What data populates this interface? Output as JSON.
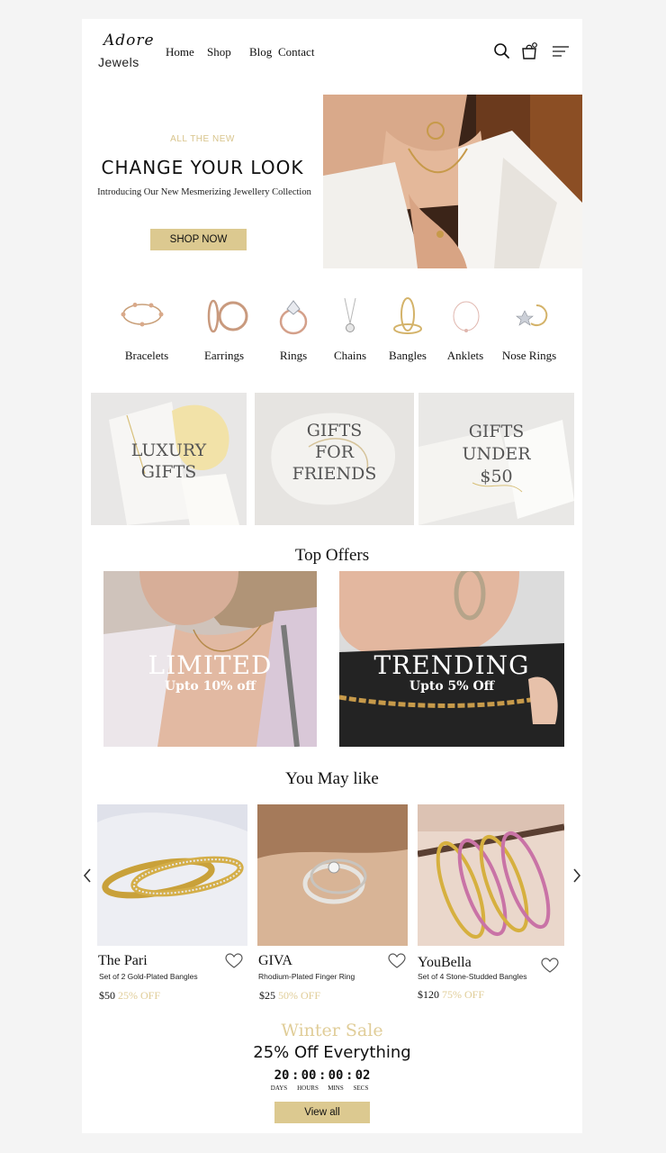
{
  "brand": {
    "script": "Adore",
    "word": "Jewels"
  },
  "nav": {
    "items": [
      "Home",
      "Shop",
      "Blog",
      "Contact"
    ]
  },
  "header_icons": [
    "search-icon",
    "cart-icon",
    "menu-icon"
  ],
  "hero": {
    "kicker": "ALL THE NEW",
    "title": "CHANGE YOUR LOOK",
    "subtitle": "Introducing Our New Mesmerizing Jewellery Collection",
    "cta": "SHOP NOW"
  },
  "categories": [
    {
      "label": "Bracelets",
      "icon": "bracelet-icon"
    },
    {
      "label": "Earrings",
      "icon": "earrings-icon"
    },
    {
      "label": "Rings",
      "icon": "ring-icon"
    },
    {
      "label": "Chains",
      "icon": "chain-icon"
    },
    {
      "label": "Bangles",
      "icon": "bangles-icon"
    },
    {
      "label": "Anklets",
      "icon": "anklet-icon"
    },
    {
      "label": "Nose Rings",
      "icon": "nose-ring-icon"
    }
  ],
  "gifts": [
    {
      "line1": "LUXURY",
      "line2": "GIFTS",
      "line3": ""
    },
    {
      "line1": "GIFTS",
      "line2": "FOR",
      "line3": "FRIENDS"
    },
    {
      "line1": "GIFTS",
      "line2": "UNDER",
      "line3": "$50"
    }
  ],
  "top_offers": {
    "title": "Top Offers",
    "items": [
      {
        "title": "LIMITED",
        "subtitle": "Upto 10% off"
      },
      {
        "title": "TRENDING",
        "subtitle": "Upto 5% Off"
      }
    ]
  },
  "you_may_like": {
    "title": "You May like",
    "products": [
      {
        "name": "The Pari",
        "desc": "Set of 2 Gold-Plated Bangles",
        "price": "$50",
        "discount": "25% OFF"
      },
      {
        "name": "GIVA",
        "desc": "Rhodium-Plated Finger Ring",
        "price": "$25",
        "discount": "50% OFF"
      },
      {
        "name": "YouBella",
        "desc": "Set of 4 Stone-Studded Bangles",
        "price": "$120",
        "discount": "75% OFF"
      }
    ]
  },
  "sale": {
    "title": "Winter Sale",
    "subtitle": "25% Off Everything",
    "countdown": {
      "days": "20",
      "hours": "00",
      "mins": "00",
      "secs": "02"
    },
    "labels": {
      "days": "DAYS",
      "hours": "HOURS",
      "mins": "MINS",
      "secs": "SECS"
    },
    "cta": "View all"
  },
  "colors": {
    "accent": "#dcc990",
    "accent_text": "#e0cd98",
    "background": "#f4f4f4",
    "surface": "#ffffff"
  }
}
